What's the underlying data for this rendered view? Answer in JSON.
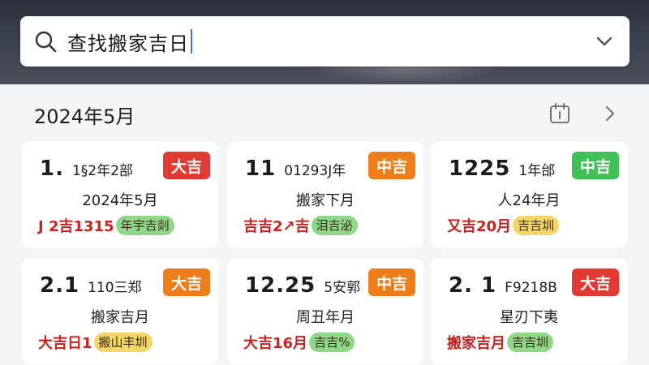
{
  "search": {
    "query": "查找搬家吉日"
  },
  "calendar": {
    "month_title": "2024年5月"
  },
  "colors": {
    "red": "#e03a33",
    "orange": "#ef7d1a",
    "green": "#3fbf55",
    "pill_yellow": "#f3d56a",
    "pill_green": "#8fd88a"
  },
  "cards": [
    {
      "big": "1.",
      "small": "1§2年2部",
      "badge": "大吉",
      "badge_color": "#e03a33",
      "line2": "2024年5月",
      "line3_red": "J 2吉1315",
      "pill": "年宇吉剡",
      "pill_color": "#8fd88a"
    },
    {
      "big": "11",
      "small": "01293J年",
      "badge": "中吉",
      "badge_color": "#ef7d1a",
      "line2": "搬家下月",
      "line3_red": "吉吉2↗吉",
      "pill": "泪吉泌",
      "pill_color": "#8fd88a"
    },
    {
      "big": "1225",
      "small": "1年邰",
      "badge": "中吉",
      "badge_color": "#3fbf55",
      "line2": "人24年月",
      "line3_red": "又吉20月",
      "pill": "吉吉圳",
      "pill_color": "#f3d56a"
    },
    {
      "big": "2.1",
      "small": "110三郑",
      "badge": "大吉",
      "badge_color": "#ef7d1a",
      "line2": "搬家吉月",
      "line3_red": "大吉日1",
      "pill": "搬山丰圳",
      "pill_color": "#f3d56a"
    },
    {
      "big": "12.25",
      "small": "5安郭",
      "badge": "中吉",
      "badge_color": "#ef7d1a",
      "line2": "周丑年月",
      "line3_red": "大吉16月",
      "pill": "吉吉%",
      "pill_color": "#8fd88a"
    },
    {
      "big": "2. 1",
      "small": "F9218B",
      "badge": "大吉",
      "badge_color": "#e03a33",
      "line2": "星刃下夷",
      "line3_red": "搬家吉月",
      "pill": "吉吉圳",
      "pill_color": "#8fd88a"
    }
  ]
}
